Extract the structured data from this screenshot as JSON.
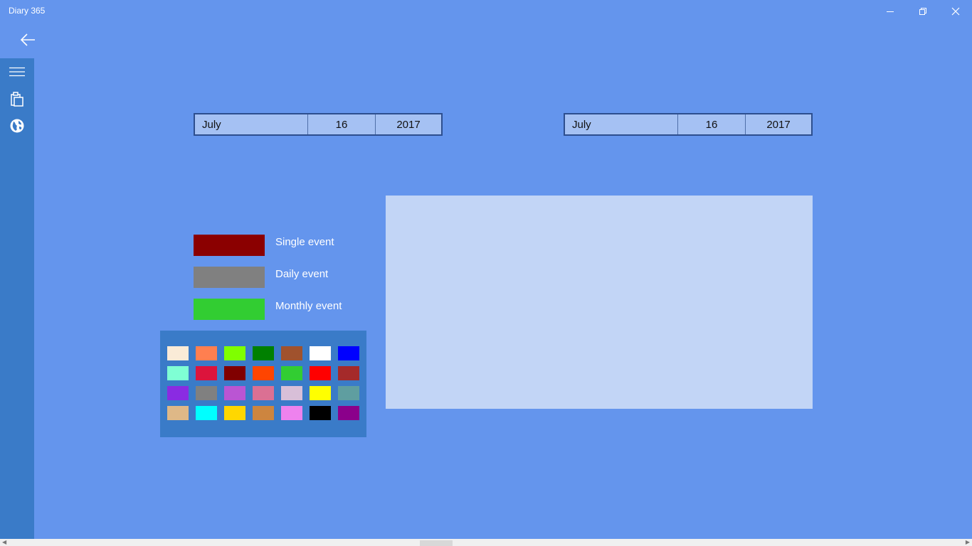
{
  "app": {
    "title": "Diary 365"
  },
  "start_date": {
    "month": "July",
    "day": "16",
    "year": "2017"
  },
  "end_date": {
    "month": "July",
    "day": "16",
    "year": "2017"
  },
  "legend": [
    {
      "label": "Single event",
      "color": "#8B0000"
    },
    {
      "label": "Daily event",
      "color": "#808080"
    },
    {
      "label": "Monthly event",
      "color": "#32CD32"
    }
  ],
  "palette": [
    [
      "#FAEBD7",
      "#FF7F50",
      "#7FFF00",
      "#008000",
      "#A0522D",
      "#FFFFFF",
      "#0000FF"
    ],
    [
      "#7FFFD4",
      "#DC143C",
      "#800000",
      "#FF4500",
      "#32CD32",
      "#FF0000",
      "#A52A2A"
    ],
    [
      "#8A2BE2",
      "#808080",
      "#BA55D3",
      "#DB7093",
      "#D8BFD8",
      "#FFFF00",
      "#5F9EA0"
    ],
    [
      "#DEB887",
      "#00FFFF",
      "#FFD700",
      "#CD853F",
      "#EE82EE",
      "#000000",
      "#8B008B"
    ]
  ],
  "icons": {
    "back": "back-arrow-icon",
    "menu": "hamburger-icon",
    "clipboard": "clipboard-icon",
    "globe": "globe-icon"
  }
}
